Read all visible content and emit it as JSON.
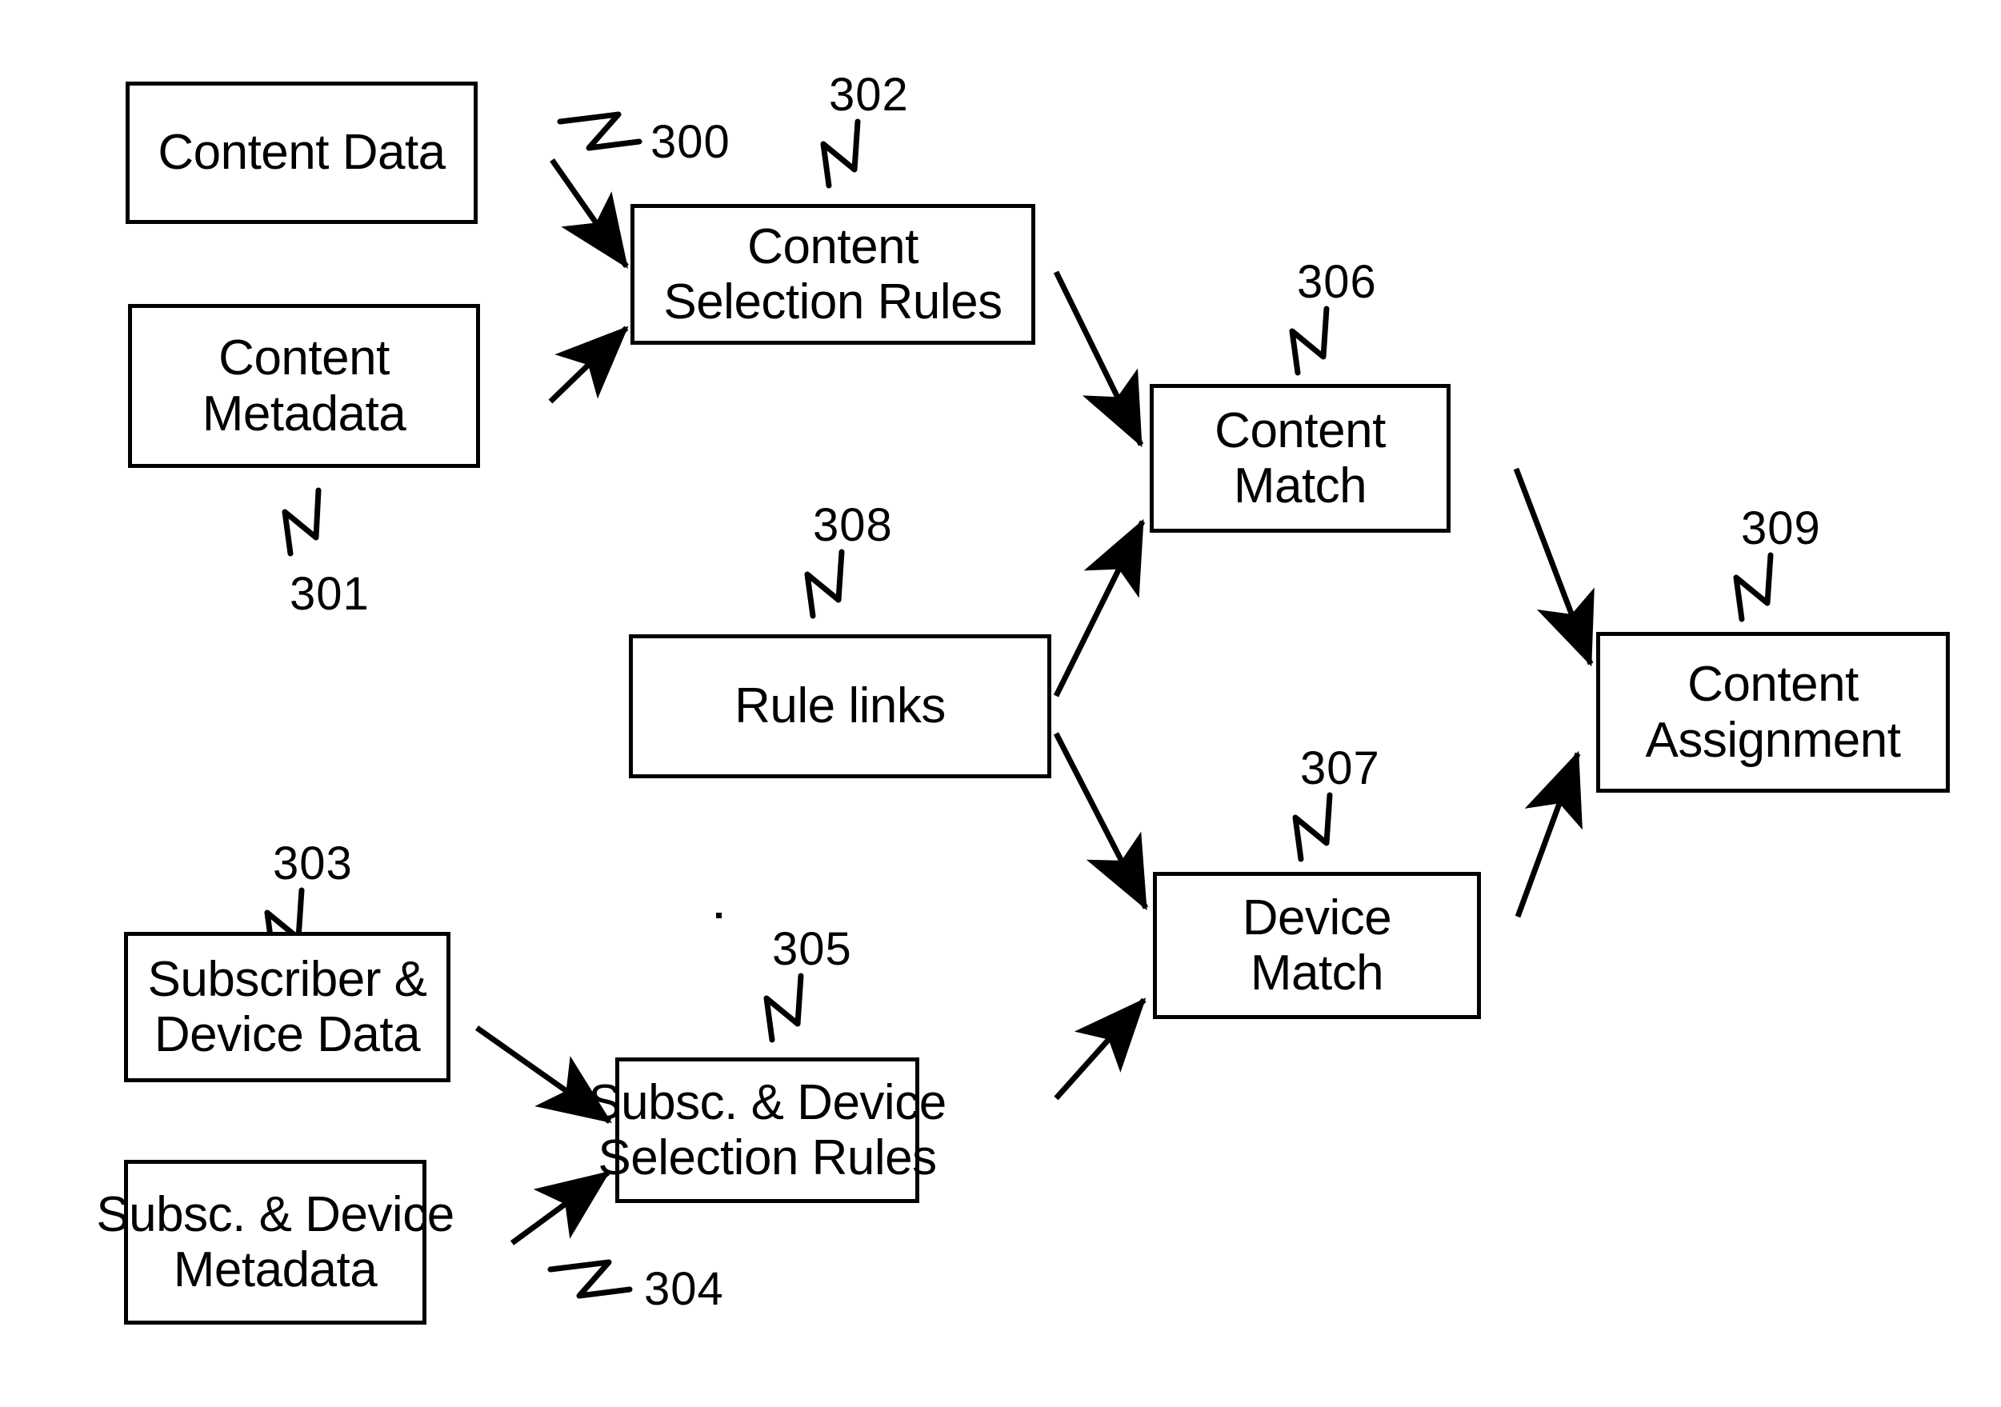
{
  "figure": {
    "title": "Content Assignment Block Diagram",
    "background_color": "#ffffff",
    "line_color": "#000000"
  },
  "nodes": {
    "content_data": {
      "line1": "Content Data",
      "line2": ""
    },
    "content_metadata": {
      "line1": "Content",
      "line2": "Metadata"
    },
    "content_selection_rules": {
      "line1": "Content",
      "line2": "Selection Rules"
    },
    "rule_links": {
      "line1": "Rule links",
      "line2": ""
    },
    "content_match": {
      "line1": "Content",
      "line2": "Match"
    },
    "device_match": {
      "line1": "Device",
      "line2": "Match"
    },
    "content_assignment": {
      "line1": "Content",
      "line2": "Assignment"
    },
    "subscriber_device_data": {
      "line1": "Subscriber &",
      "line2": "Device Data"
    },
    "subsc_device_metadata": {
      "line1": "Subsc. & Device",
      "line2": "Metadata"
    },
    "subsc_device_rules": {
      "line1": "Subsc. & Device",
      "line2": "Selection Rules"
    }
  },
  "reference_numerals": {
    "content_data": "300",
    "content_metadata": "301",
    "content_selection_rules": "302",
    "subscriber_device_data": "303",
    "subsc_device_metadata": "304",
    "subsc_device_rules": "305",
    "content_match": "306",
    "device_match": "307",
    "rule_links": "308",
    "content_assignment": "309"
  },
  "connections": [
    {
      "from": "content_data",
      "to": "content_selection_rules",
      "arrow": "single"
    },
    {
      "from": "content_metadata",
      "to": "content_selection_rules",
      "arrow": "single"
    },
    {
      "from": "content_selection_rules",
      "to": "content_match",
      "arrow": "single"
    },
    {
      "from": "rule_links",
      "to": "content_match",
      "arrow": "single"
    },
    {
      "from": "rule_links",
      "to": "device_match",
      "arrow": "single"
    },
    {
      "from": "content_match",
      "to": "content_assignment",
      "arrow": "single"
    },
    {
      "from": "device_match",
      "to": "content_assignment",
      "arrow": "single"
    },
    {
      "from": "subscriber_device_data",
      "to": "subsc_device_rules",
      "arrow": "single"
    },
    {
      "from": "subsc_device_metadata",
      "to": "subsc_device_rules",
      "arrow": "single"
    },
    {
      "from": "subsc_device_rules",
      "to": "device_match",
      "arrow": "single"
    }
  ]
}
